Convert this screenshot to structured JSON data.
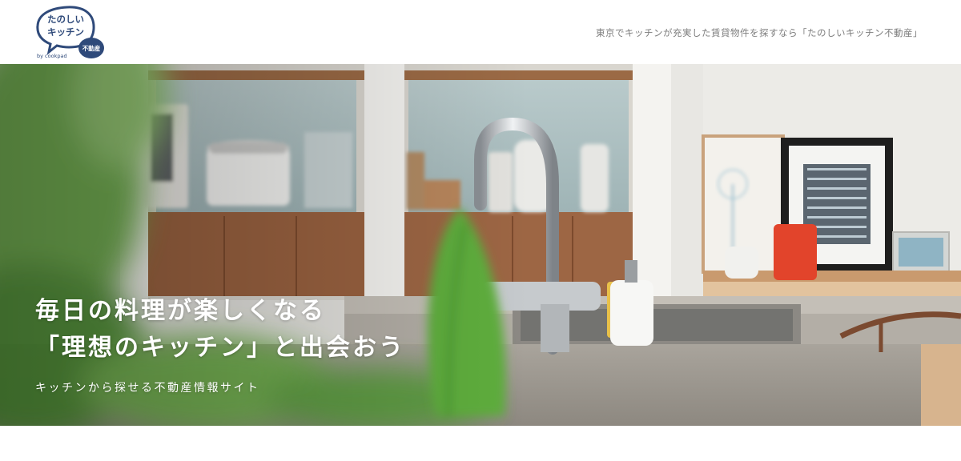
{
  "header": {
    "logo": {
      "line1": "たのしい",
      "line2": "キッチン",
      "byline": "by cookpad",
      "badge": "不動産",
      "brand_color": "#2f4a7a"
    },
    "tagline": "東京でキッチンが充実した賃貸物件を探すなら「たのしいキッチン不動産」"
  },
  "hero": {
    "headline_line1": "毎日の料理が楽しくなる",
    "headline_line2": "「理想のキッチン」と出会おう",
    "subline": "キッチンから探せる不動産情報サイト",
    "image": "kitchen-photo"
  }
}
